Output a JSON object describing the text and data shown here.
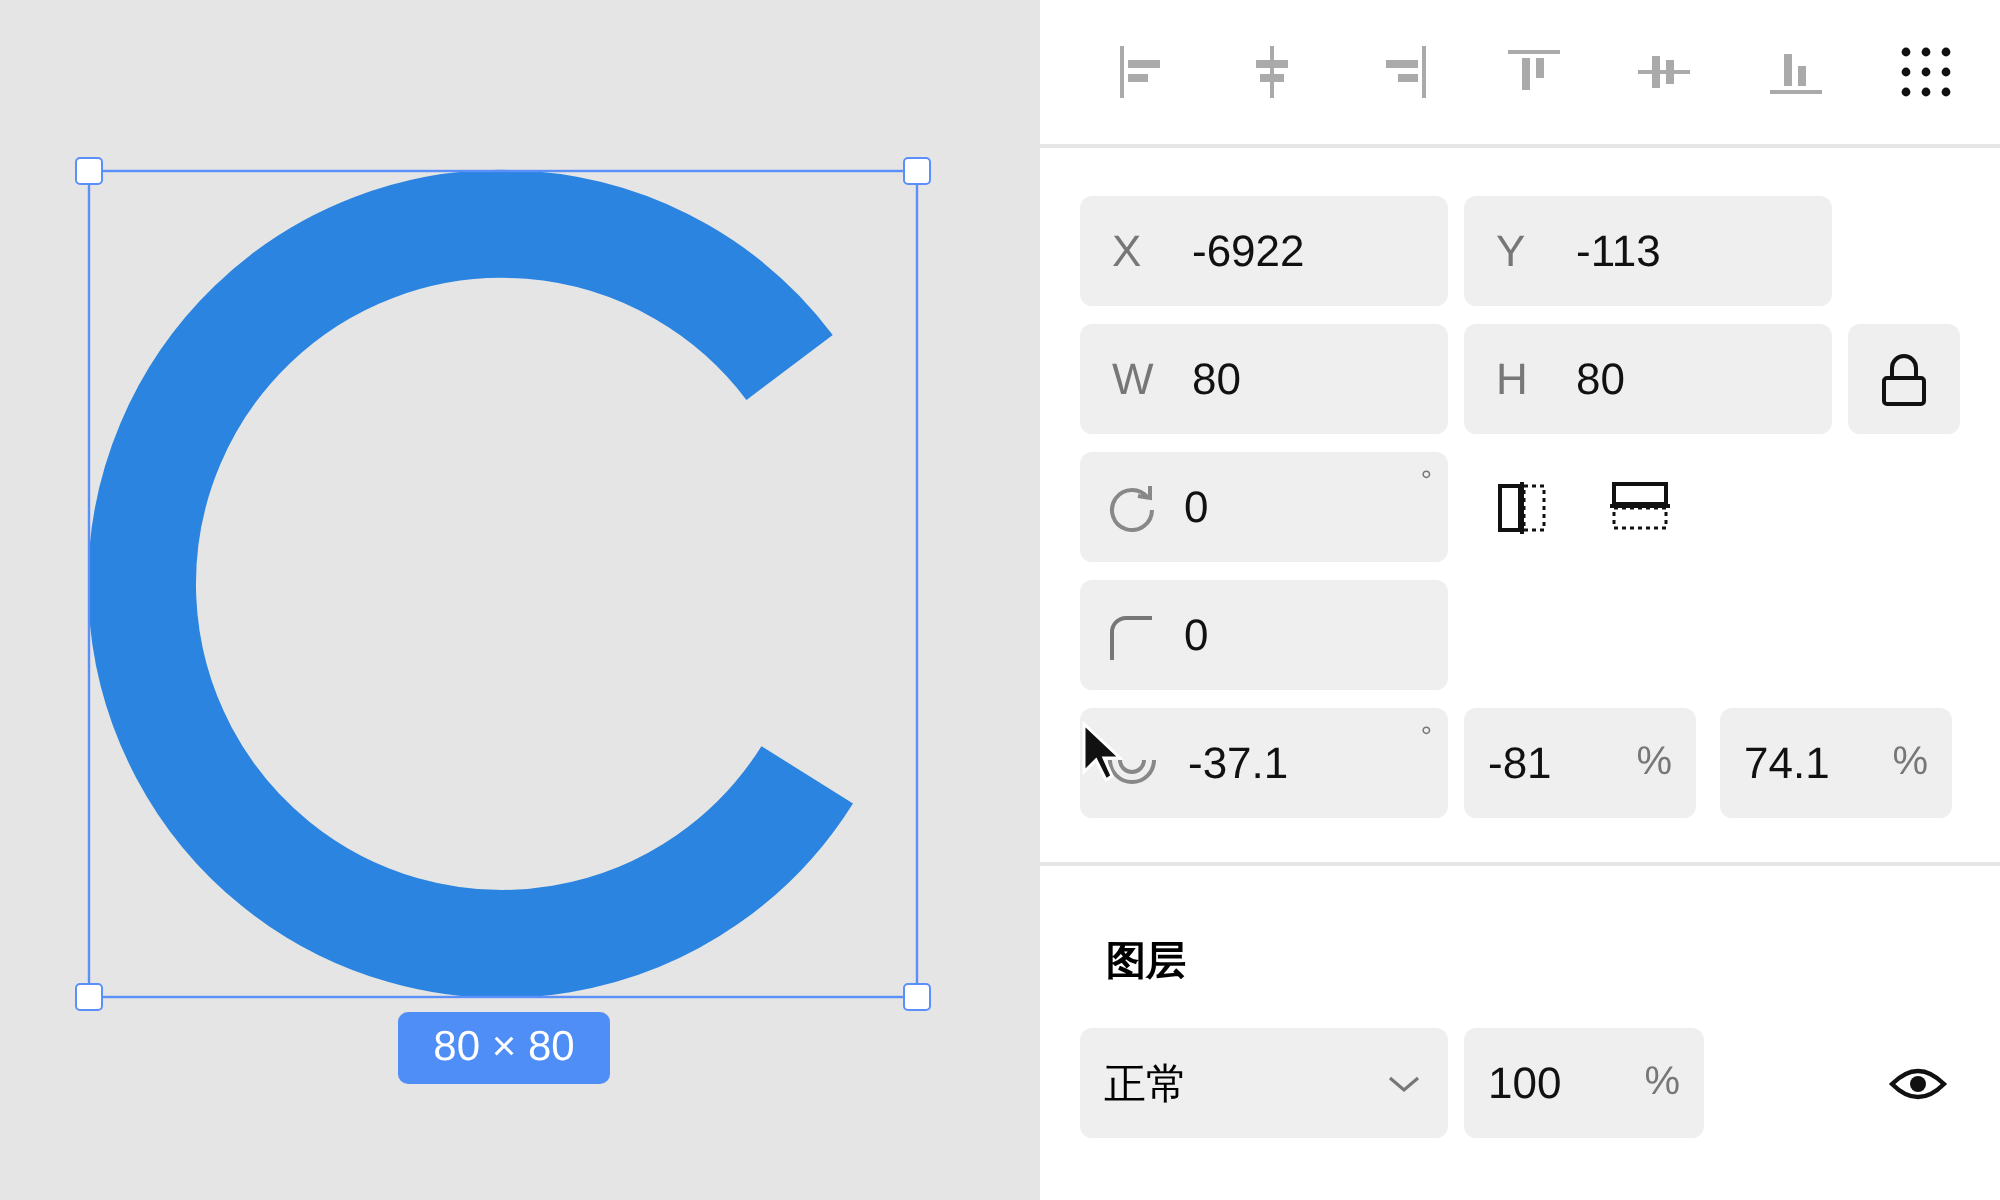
{
  "canvas": {
    "size_badge": "80 × 80"
  },
  "align_tools": [
    {
      "kind": "left",
      "disabled": true
    },
    {
      "kind": "hcenter",
      "disabled": true
    },
    {
      "kind": "right",
      "disabled": true
    },
    {
      "kind": "top",
      "disabled": true
    },
    {
      "kind": "vcenter",
      "disabled": true
    },
    {
      "kind": "bottom",
      "disabled": true
    },
    {
      "kind": "more",
      "disabled": false
    }
  ],
  "position": [
    {
      "label": "X",
      "value": "-6922"
    },
    {
      "label": "Y",
      "value": "-113"
    }
  ],
  "size": [
    {
      "label": "W",
      "value": "80"
    },
    {
      "label": "H",
      "value": "80"
    }
  ],
  "rotation": {
    "value": "0",
    "unit": "°"
  },
  "corner_radius": {
    "value": "0"
  },
  "arc": [
    {
      "value": "-37.1",
      "unit": "°"
    },
    {
      "value": "-81",
      "unit": "%"
    },
    {
      "value": "74.1",
      "unit": "%"
    }
  ],
  "layer": {
    "title": "图层",
    "blend_mode": "正常",
    "opacity": "100",
    "unit": "%"
  }
}
